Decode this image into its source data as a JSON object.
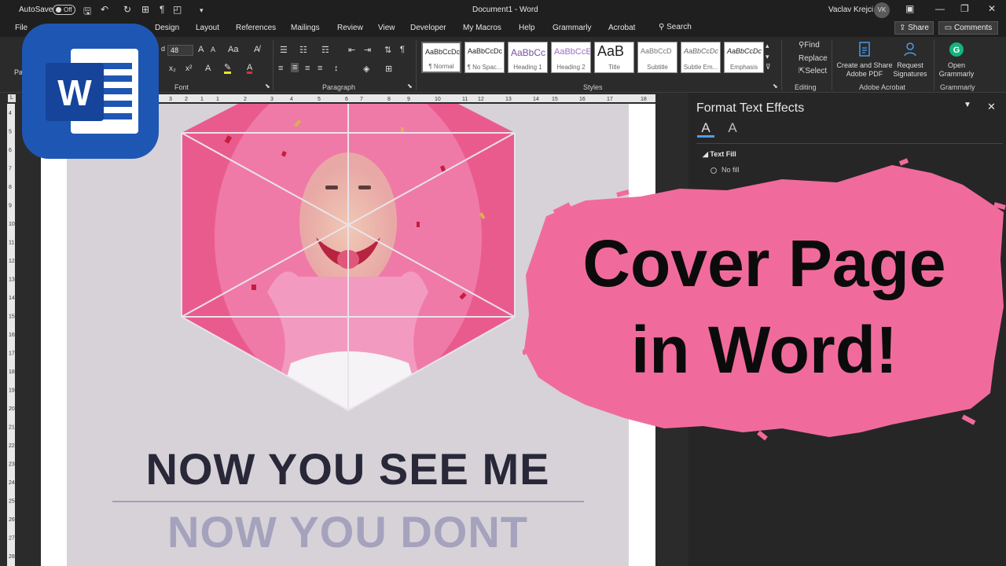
{
  "titlebar": {
    "autosave": "AutoSave",
    "toggle": "Off",
    "document": "Document1 - Word",
    "user": "Vaclav Krejci",
    "initials": "VK"
  },
  "menu": [
    "File",
    "Design",
    "Layout",
    "References",
    "Mailings",
    "Review",
    "View",
    "Developer",
    "My Macros",
    "Help",
    "Grammarly",
    "Acrobat"
  ],
  "search": "Search",
  "share": "Share",
  "comments": "Comments",
  "ribbon": {
    "paste": "Pa",
    "font_size": "48",
    "groups": {
      "font": "Font",
      "paragraph": "Paragraph",
      "styles": "Styles",
      "editing": "Editing",
      "acrobat": "Adobe Acrobat",
      "grammarly": "Grammarly"
    },
    "styles": [
      {
        "preview": "AaBbCcDc",
        "name": "¶ Normal"
      },
      {
        "preview": "AaBbCcDc",
        "name": "¶ No Spac..."
      },
      {
        "preview": "AaBbCc",
        "name": "Heading 1"
      },
      {
        "preview": "AaBbCcE",
        "name": "Heading 2"
      },
      {
        "preview": "AaB",
        "name": "Title"
      },
      {
        "preview": "AaBbCcD",
        "name": "Subtitle"
      },
      {
        "preview": "AaBbCcDc",
        "name": "Subtle Em..."
      },
      {
        "preview": "AaBbCcDc",
        "name": "Emphasis"
      }
    ],
    "editing": {
      "find": "Find",
      "replace": "Replace",
      "select": "Select"
    },
    "acrobat": {
      "create": "Create and Share",
      "create2": "Adobe PDF",
      "request": "Request",
      "request2": "Signatures"
    },
    "grammarly": {
      "open": "Open",
      "open2": "Grammarly"
    }
  },
  "ruler": [
    "3",
    "2",
    "1",
    "1",
    "2",
    "3",
    "4",
    "5",
    "6",
    "7",
    "8",
    "9",
    "10",
    "11",
    "12",
    "13",
    "14",
    "15",
    "16",
    "17",
    "18"
  ],
  "vruler": [
    "4",
    "5",
    "6",
    "7",
    "8",
    "9",
    "10",
    "11",
    "12",
    "13",
    "14",
    "15",
    "16",
    "17",
    "18",
    "19",
    "20",
    "21",
    "22",
    "23",
    "24",
    "25",
    "26",
    "27",
    "28"
  ],
  "document": {
    "line1": "NOW YOU SEE ME",
    "line2": "NOW YOU DONT"
  },
  "pane": {
    "title": "Format Text Effects",
    "section": "Text Fill",
    "option": "No fill"
  },
  "overlay": {
    "line1": "Cover Page",
    "line2": "in Word!"
  },
  "colors": {
    "accent": "#f06b9c",
    "cover_bg": "#d6d2d8",
    "title_dark": "#292838",
    "title_light": "#a5a2bd",
    "word_blue": "#1e56b4"
  }
}
